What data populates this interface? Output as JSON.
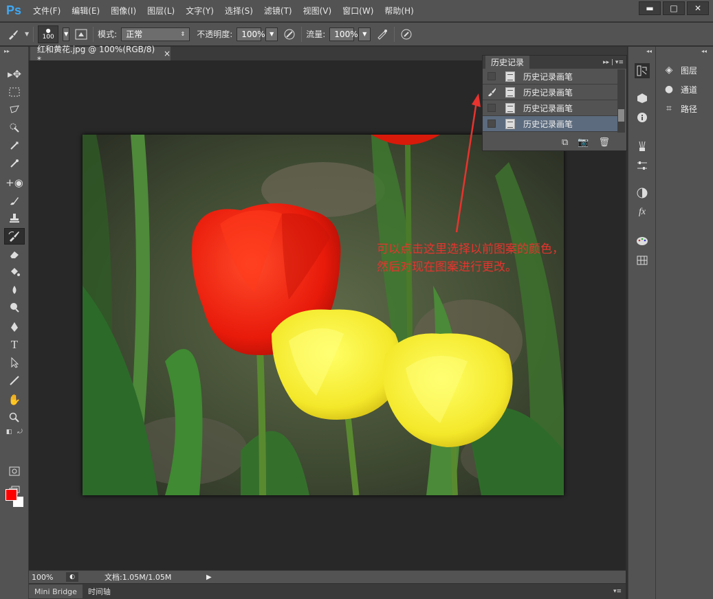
{
  "app": {
    "logo": "Ps"
  },
  "menu": [
    "文件(F)",
    "编辑(E)",
    "图像(I)",
    "图层(L)",
    "文字(Y)",
    "选择(S)",
    "滤镜(T)",
    "视图(V)",
    "窗口(W)",
    "帮助(H)"
  ],
  "window_controls": {
    "minimize": "▬",
    "maximize": "□",
    "close": "✕"
  },
  "options": {
    "brush_size": "100",
    "mode_label": "模式:",
    "mode_value": "正常",
    "opacity_label": "不透明度:",
    "opacity_value": "100%",
    "flow_label": "流量:",
    "flow_value": "100%"
  },
  "document": {
    "tab_title": "红和黄花.jpg @ 100%(RGB/8) *",
    "close": "×"
  },
  "status": {
    "zoom": "100%",
    "doc_size": "文档:1.05M/1.05M"
  },
  "bottom_tabs": [
    "Mini Bridge",
    "时间轴"
  ],
  "history": {
    "title": "历史记录",
    "rows": [
      {
        "label": "历史记录画笔",
        "source": false,
        "selected": false
      },
      {
        "label": "历史记录画笔",
        "source": true,
        "selected": false
      },
      {
        "label": "历史记录画笔",
        "source": false,
        "selected": false
      },
      {
        "label": "历史记录画笔",
        "source": false,
        "selected": true
      }
    ]
  },
  "annotation": {
    "line1": "可以点击这里选择以前图案的颜色，",
    "line2": "然后对现在图案进行更改。"
  },
  "right_panels": [
    "图层",
    "通道",
    "路径"
  ],
  "colors": {
    "foreground": "#ff0000",
    "background": "#ffffff",
    "annotation": "#e8332e",
    "ps_blue": "#3ea9f5"
  }
}
